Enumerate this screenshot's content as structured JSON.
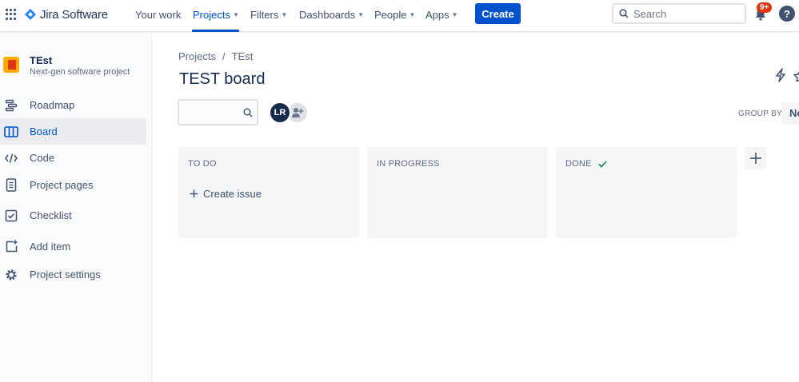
{
  "nav": {
    "logo_text": "Jira Software",
    "items": [
      {
        "label": "Your work",
        "has_menu": false
      },
      {
        "label": "Projects",
        "has_menu": true,
        "active": true
      },
      {
        "label": "Filters",
        "has_menu": true
      },
      {
        "label": "Dashboards",
        "has_menu": true
      },
      {
        "label": "People",
        "has_menu": true
      },
      {
        "label": "Apps",
        "has_menu": true
      }
    ],
    "create_label": "Create",
    "search_placeholder": "Search",
    "notification_count": "9+",
    "help_label": "?"
  },
  "sidebar": {
    "project_name": "TEst",
    "project_type": "Next-gen software project",
    "items": [
      {
        "label": "Roadmap",
        "icon": "roadmap-icon"
      },
      {
        "label": "Board",
        "icon": "board-icon",
        "active": true
      },
      {
        "label": "Code",
        "icon": "code-icon"
      },
      {
        "label": "Project pages",
        "icon": "page-icon"
      },
      {
        "label": "Checklist",
        "icon": "checklist-icon"
      },
      {
        "label": "Add item",
        "icon": "add-item-icon"
      },
      {
        "label": "Project settings",
        "icon": "gear-icon"
      }
    ]
  },
  "main": {
    "breadcrumb": [
      "Projects",
      "/",
      "TEst"
    ],
    "title": "TEST board",
    "avatar_initials": "LR",
    "group_by_label": "GROUP BY",
    "group_by_value": "No",
    "columns": [
      {
        "title": "TO DO",
        "create_label": "Create issue"
      },
      {
        "title": "IN PROGRESS"
      },
      {
        "title": "DONE",
        "done": true
      }
    ]
  },
  "colors": {
    "accent": "#0052cc",
    "badge": "#de350b",
    "done_check": "#00875a",
    "column_bg": "#f4f5f7"
  }
}
